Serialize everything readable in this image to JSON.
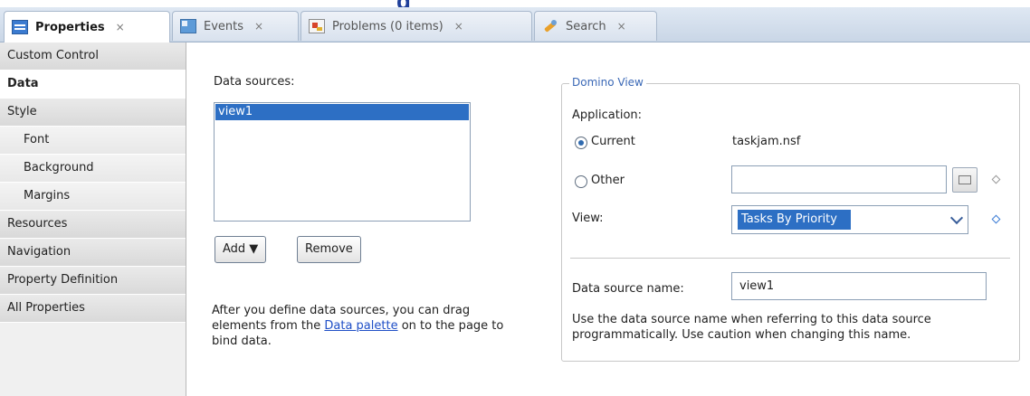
{
  "tabs": [
    {
      "label": "Properties",
      "icon": "properties-icon",
      "active": true
    },
    {
      "label": "Events",
      "icon": "events-icon",
      "active": false
    },
    {
      "label": "Problems (0 items)",
      "icon": "problems-icon",
      "active": false
    },
    {
      "label": "Search",
      "icon": "search-icon",
      "active": false
    }
  ],
  "tab_close_glyph": "×",
  "sidebar": {
    "items": [
      {
        "label": "Custom Control"
      },
      {
        "label": "Data",
        "selected": true
      },
      {
        "label": "Style"
      },
      {
        "label": "Font",
        "sub": true
      },
      {
        "label": "Background",
        "sub": true
      },
      {
        "label": "Margins",
        "sub": true
      },
      {
        "label": "Resources"
      },
      {
        "label": "Navigation"
      },
      {
        "label": "Property Definition"
      },
      {
        "label": "All Properties"
      }
    ]
  },
  "datasources": {
    "label": "Data sources:",
    "items": [
      "view1"
    ],
    "add_label": "Add ▼",
    "remove_label": "Remove",
    "help_before": "After you define data sources, you can drag elements from the ",
    "help_link": "Data palette",
    "help_after": " on to the page to bind data."
  },
  "domino": {
    "title": "Domino View",
    "application_label": "Application:",
    "current_label": "Current",
    "current_value": "taskjam.nsf",
    "other_label": "Other",
    "other_value": "",
    "view_label": "View:",
    "view_value": "Tasks By Priority",
    "dsname_label": "Data source name:",
    "dsname_value": "view1",
    "note": "Use the data source name when referring to this data source programmatically. Use caution when changing this name."
  }
}
